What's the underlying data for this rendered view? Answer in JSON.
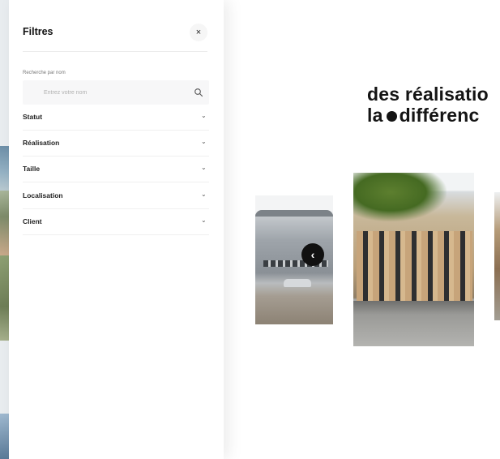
{
  "page": {
    "headline": {
      "line1": "des réalisatio",
      "line2_prefix": "la",
      "line2_suffix": "différenc"
    },
    "carousel": {
      "prev_icon": "chevron-left-icon",
      "prev_glyph": "‹"
    }
  },
  "filters": {
    "title": "Filtres",
    "close_glyph": "×",
    "search": {
      "label": "Recherche par nom",
      "placeholder": "Entrez votre nom",
      "icon": "search-icon"
    },
    "items": [
      {
        "label": "Statut",
        "chevron": "⌄"
      },
      {
        "label": "Réalisation",
        "chevron": "⌄"
      },
      {
        "label": "Taille",
        "chevron": "⌄"
      },
      {
        "label": "Localisation",
        "chevron": "⌄"
      },
      {
        "label": "Client",
        "chevron": "⌄"
      }
    ]
  },
  "colors": {
    "accent": "#111111",
    "panel_bg": "#ffffff",
    "input_bg": "#f7f7f8"
  }
}
